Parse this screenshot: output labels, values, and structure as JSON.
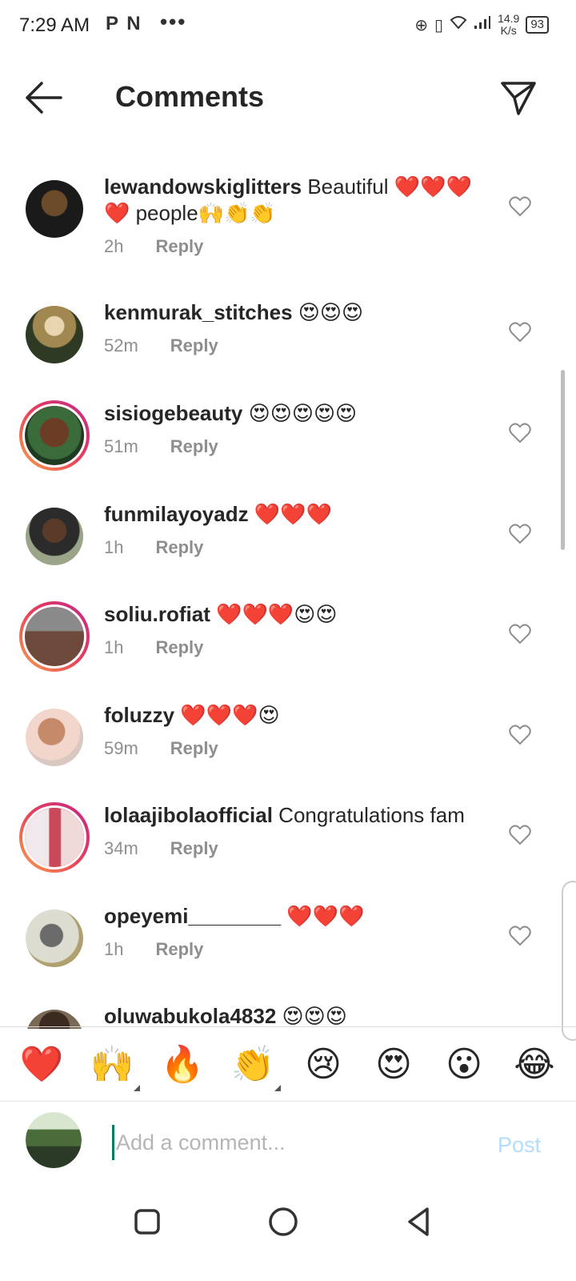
{
  "status_bar": {
    "time": "7:29 AM",
    "app_icons": "P N",
    "more": "•••",
    "net_speed_value": "14.9",
    "net_speed_unit": "K/s",
    "battery": "93"
  },
  "header": {
    "title": "Comments",
    "back_icon": "arrow-left-icon",
    "send_icon": "paper-plane-icon"
  },
  "comments": [
    {
      "username": "lewandowskiglitters",
      "text": "Beautiful ❤️❤️❤️❤️ people🙌👏👏",
      "time": "2h",
      "reply": "Reply",
      "story": false
    },
    {
      "username": "kenmurak_stitches",
      "text": "😍😍😍",
      "time": "52m",
      "reply": "Reply",
      "story": false
    },
    {
      "username": "sisiogebeauty",
      "text": "😍😍😍😍😍",
      "time": "51m",
      "reply": "Reply",
      "story": true
    },
    {
      "username": "funmilayoyadz",
      "text": "❤️❤️❤️",
      "time": "1h",
      "reply": "Reply",
      "story": false
    },
    {
      "username": "soliu.rofiat",
      "text": "❤️❤️❤️😍😍",
      "time": "1h",
      "reply": "Reply",
      "story": true
    },
    {
      "username": "foluzzy",
      "text": "❤️❤️❤️😍",
      "time": "59m",
      "reply": "Reply",
      "story": false
    },
    {
      "username": "lolaajibolaofficial",
      "text": "Congratulations fam",
      "time": "34m",
      "reply": "Reply",
      "story": true
    },
    {
      "username": "opeyemi________",
      "text": "❤️❤️❤️",
      "time": "1h",
      "reply": "Reply",
      "story": false
    },
    {
      "username": "oluwabukola4832",
      "text": "😍😍😍",
      "time": "",
      "reply": "",
      "story": false
    }
  ],
  "quick_emojis": [
    "❤️",
    "🙌",
    "🔥",
    "👏",
    "😢",
    "😍",
    "😮",
    "😂"
  ],
  "composer": {
    "placeholder": "Add a comment...",
    "post_label": "Post"
  },
  "colors": {
    "text": "#262626",
    "meta": "#8e8e8e",
    "post": "#b3dbff",
    "story_ring": "#e8405a"
  }
}
